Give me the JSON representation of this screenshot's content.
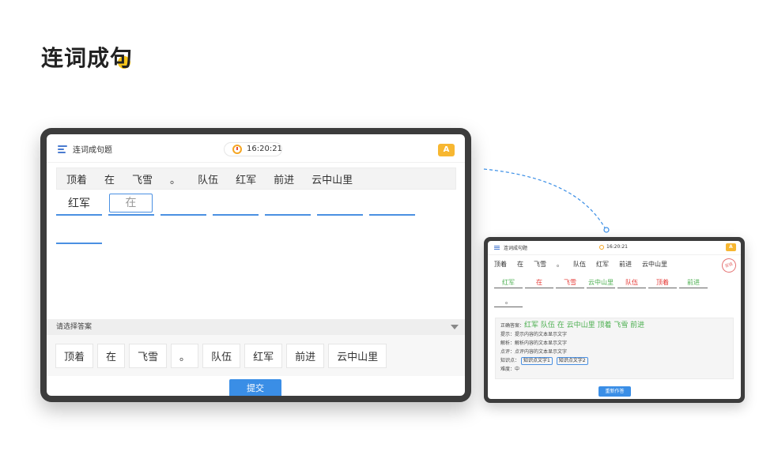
{
  "page": {
    "title": "连词成句"
  },
  "colors": {
    "accent": "#3a8ee6",
    "highlight": "#f9c619",
    "correct": "#4caf50",
    "wrong": "#e53935"
  },
  "big": {
    "header_title": "连词成句题",
    "timer": "16:20:21",
    "font_btn": "A",
    "pool": [
      "顶着",
      "在",
      "飞雪",
      "。",
      "队伍",
      "红军",
      "前进",
      "云中山里"
    ],
    "blanks": [
      "红军",
      "在",
      "",
      "",
      "",
      "",
      "",
      ""
    ],
    "answer_label": "请选择答案",
    "options": [
      "顶着",
      "在",
      "飞雪",
      "。",
      "队伍",
      "红军",
      "前进",
      "云中山里"
    ],
    "submit": "提交"
  },
  "small": {
    "header_title": "连词成句题",
    "timer": "16:20:21",
    "font_btn": "A",
    "stamp": "答错",
    "pool": [
      "顶着",
      "在",
      "飞雪",
      "。",
      "队伍",
      "红军",
      "前进",
      "云中山里"
    ],
    "blanks": [
      {
        "text": "红军",
        "status": "ok"
      },
      {
        "text": "在",
        "status": "bad"
      },
      {
        "text": "飞雪",
        "status": "bad"
      },
      {
        "text": "云中山里",
        "status": "ok"
      },
      {
        "text": "队伍",
        "status": "bad"
      },
      {
        "text": "顶着",
        "status": "bad"
      },
      {
        "text": "前进",
        "status": "ok"
      },
      {
        "text": "。",
        "status": "none"
      }
    ],
    "result": {
      "correct_label": "正确答案：",
      "correct_answer": "红军 队伍 在 云中山里 顶着 飞雪 前进",
      "hint": "提示：提示内容的文本显示文字",
      "analysis": "解析：解析内容的文本显示文字",
      "comment": "点评：点评内容的文本显示文字",
      "knowledge_label": "知识点：",
      "knowledge_tags": [
        "知识点文字1",
        "知识点文字2"
      ],
      "difficulty": "难度：中"
    },
    "retry": "重新作答"
  }
}
